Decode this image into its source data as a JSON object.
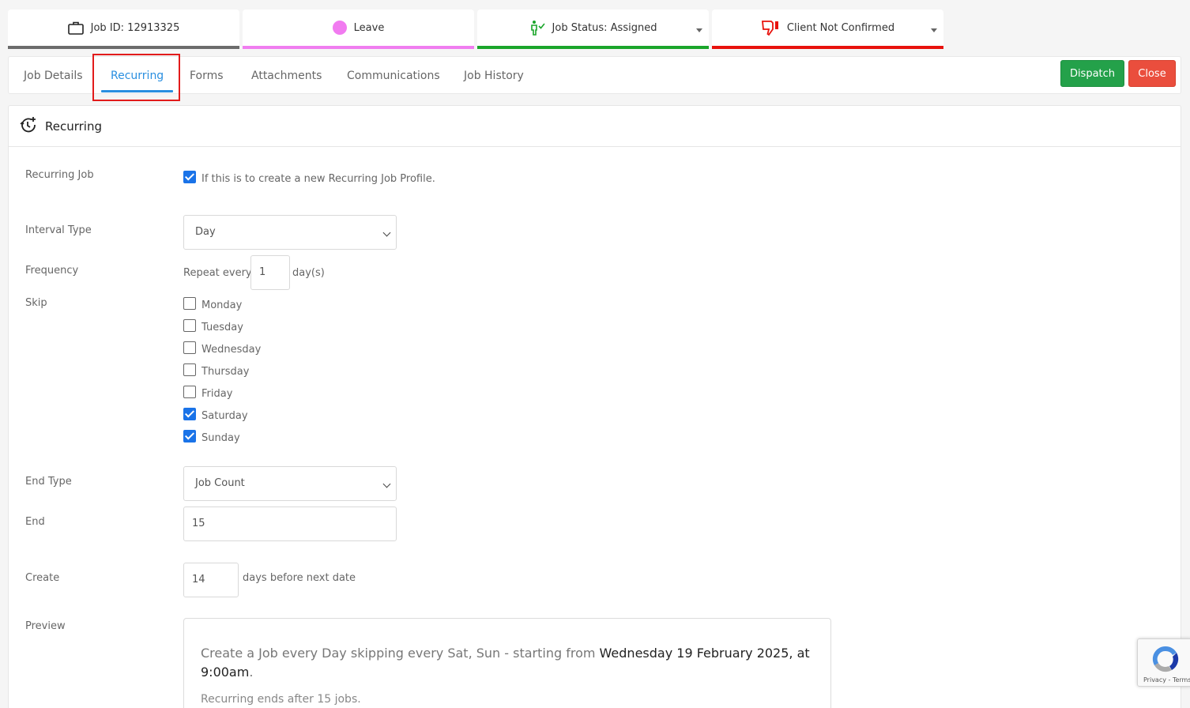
{
  "status_cards": {
    "job_id": "Job ID: 12913325",
    "leave": "Leave",
    "job_status": "Job Status: Assigned",
    "client": "Client Not Confirmed"
  },
  "tabs": [
    {
      "label": "Job Details"
    },
    {
      "label": "Recurring",
      "active": true
    },
    {
      "label": "Forms"
    },
    {
      "label": "Attachments"
    },
    {
      "label": "Communications"
    },
    {
      "label": "Job History"
    }
  ],
  "buttons": {
    "dispatch": "Dispatch",
    "close": "Close"
  },
  "panel": {
    "title": "Recurring"
  },
  "form": {
    "recurring_job": {
      "label": "Recurring Job",
      "checked": true,
      "text": "If this is to create a new Recurring Job Profile."
    },
    "interval_type": {
      "label": "Interval Type",
      "value": "Day"
    },
    "frequency": {
      "label": "Frequency",
      "prefix": "Repeat every",
      "value": "1",
      "suffix": "day(s)"
    },
    "skip": {
      "label": "Skip",
      "days": [
        {
          "name": "Monday",
          "checked": false
        },
        {
          "name": "Tuesday",
          "checked": false
        },
        {
          "name": "Wednesday",
          "checked": false
        },
        {
          "name": "Thursday",
          "checked": false
        },
        {
          "name": "Friday",
          "checked": false
        },
        {
          "name": "Saturday",
          "checked": true
        },
        {
          "name": "Sunday",
          "checked": true
        }
      ]
    },
    "end_type": {
      "label": "End Type",
      "value": "Job Count"
    },
    "end": {
      "label": "End",
      "value": "15"
    },
    "create": {
      "label": "Create",
      "value": "14",
      "suffix": "days before next date"
    },
    "preview": {
      "label": "Preview",
      "text": "Create a Job every Day skipping every Sat, Sun - starting from",
      "date_text": "Wednesday 19 February 2025, at 9:00am",
      "end_text": "Recurring ends after 15 jobs."
    }
  },
  "recaptcha": {
    "links": "Privacy - Terms"
  },
  "colors": {
    "accent": "#2a8fe0",
    "dispatch": "#24a14a",
    "close": "#ea4e3d",
    "checkbox": "#1a73e8",
    "leave": "#f17bf0",
    "status": "#1aa52a",
    "client": "#e8120c"
  }
}
